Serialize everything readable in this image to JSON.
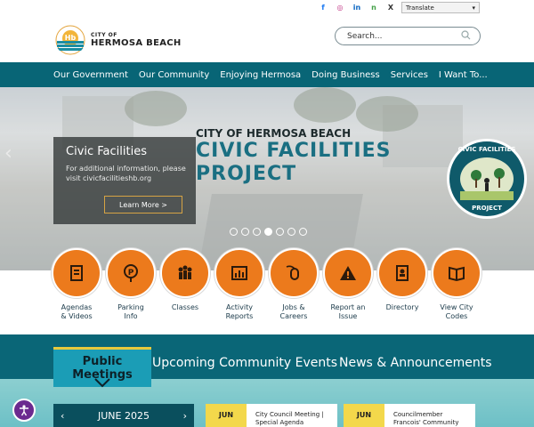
{
  "colors": {
    "nav": "#086576",
    "accent": "#ec7a1c",
    "teal": "#1a6f82",
    "yellow": "#f3d84b"
  },
  "social": [
    {
      "icon": "facebook-icon",
      "glyph": "f",
      "color": "#1877f2"
    },
    {
      "icon": "instagram-icon",
      "glyph": "◎",
      "color": "#c13584"
    },
    {
      "icon": "linkedin-icon",
      "glyph": "in",
      "color": "#0a66c2"
    },
    {
      "icon": "nextdoor-icon",
      "glyph": "n",
      "color": "#43a047"
    },
    {
      "icon": "x-icon",
      "glyph": "X",
      "color": "#333"
    }
  ],
  "translate_label": "Translate",
  "logo": {
    "small": "CITY OF",
    "big": "HERMOSA BEACH",
    "mark": "Hb"
  },
  "search_placeholder": "Search...",
  "nav": [
    "Our Government",
    "Our Community",
    "Enjoying Hermosa",
    "Doing Business",
    "Services",
    "I Want To..."
  ],
  "hero": {
    "card_title": "Civic Facilities",
    "card_text": "For additional information, please visit civicfacilitieshb.org",
    "card_button": "Learn More >",
    "title_line1": "CITY OF HERMOSA BEACH",
    "title_line2": "CIVIC FACILITIES",
    "title_line3": "PROJECT",
    "badge_top": "CIVIC FACILITIES",
    "badge_bottom": "PROJECT",
    "dots": 7,
    "active_dot": 3
  },
  "quick_links": [
    {
      "label": "Agendas\n& Videos",
      "icon": "document-icon"
    },
    {
      "label": "Parking\nInfo",
      "icon": "parking-icon"
    },
    {
      "label": "Classes",
      "icon": "people-icon"
    },
    {
      "label": "Activity\nReports",
      "icon": "chart-icon"
    },
    {
      "label": "Jobs &\nCareers",
      "icon": "mouse-icon"
    },
    {
      "label": "Report an\nIssue",
      "icon": "warning-icon"
    },
    {
      "label": "Directory",
      "icon": "directory-icon"
    },
    {
      "label": "View City\nCodes",
      "icon": "book-icon"
    }
  ],
  "tabs": [
    "Public Meetings",
    "Upcoming Community Events",
    "News & Announcements"
  ],
  "calendar_month": "JUNE 2025",
  "events": [
    {
      "date": "JUN",
      "title": "City Council Meeting |\nSpecial Agenda"
    },
    {
      "date": "JUN",
      "title": "Councilmember\nFrancois' Community"
    }
  ]
}
